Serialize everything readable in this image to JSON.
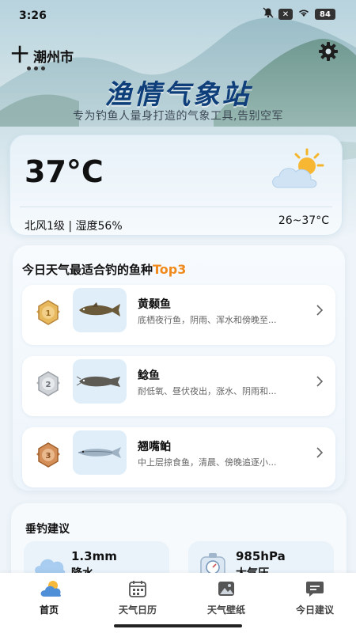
{
  "status_bar": {
    "time": "3:26",
    "battery": "84"
  },
  "location": {
    "plus": "十",
    "city": "潮州市"
  },
  "app": {
    "title": "渔情气象站",
    "subtitle": "专为钓鱼人量身打造的气象工具,告别空军"
  },
  "weather": {
    "temperature": "37°C",
    "wind_humidity": "北风1级 | 湿度56%",
    "range": "26~37°C",
    "icon": "partly-sunny-icon"
  },
  "fish": {
    "header_prefix": "今日天气最适合钓的鱼种",
    "header_badge": "Top3",
    "items": [
      {
        "name": "黄颡鱼",
        "desc": "底栖夜行鱼，阴雨、浑水和傍晚至...",
        "medal": "gold",
        "rank": "1"
      },
      {
        "name": "鲶鱼",
        "desc": "耐低氧、昼伏夜出，涨水、阴雨和...",
        "medal": "silver",
        "rank": "2"
      },
      {
        "name": "翘嘴鲌",
        "desc": "中上层掠食鱼，清晨、傍晚追逐小...",
        "medal": "bronze",
        "rank": "3"
      }
    ]
  },
  "advice": {
    "title": "垂钓建议",
    "items": [
      {
        "value": "1.3mm",
        "label": "降水",
        "icon": "rain-cloud-icon"
      },
      {
        "value": "985hPa",
        "label": "大气压",
        "icon": "barometer-icon"
      }
    ]
  },
  "nav": {
    "items": [
      {
        "label": "首页",
        "icon": "home-weather-icon",
        "active": true
      },
      {
        "label": "天气日历",
        "icon": "calendar-icon",
        "active": false
      },
      {
        "label": "天气壁纸",
        "icon": "wallpaper-icon",
        "active": false
      },
      {
        "label": "今日建议",
        "icon": "message-icon",
        "active": false
      }
    ]
  },
  "colors": {
    "title": "#0f3f7a",
    "badge": "#f08a1d",
    "background": "#eef4f9"
  }
}
